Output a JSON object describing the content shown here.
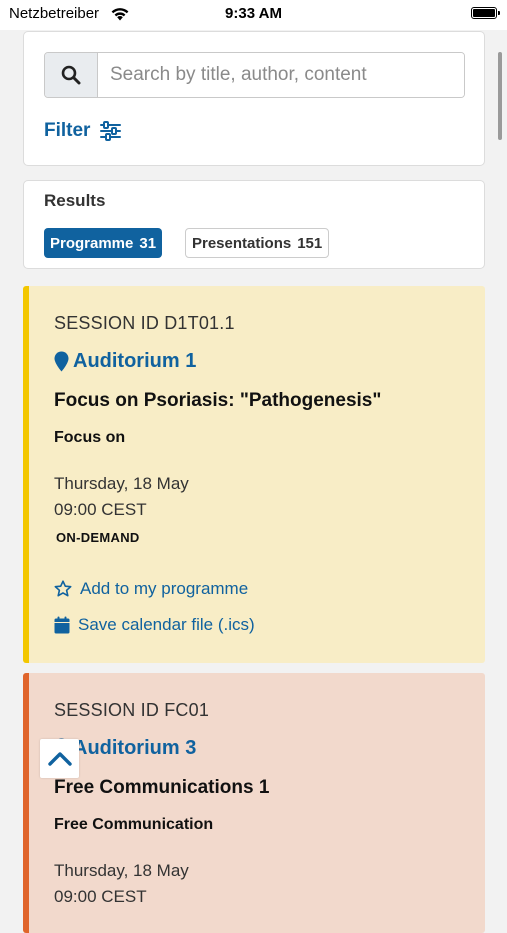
{
  "status_bar": {
    "carrier": "Netzbetreiber",
    "time": "9:33 AM"
  },
  "search": {
    "placeholder": "Search by title, author, content",
    "value": ""
  },
  "filter": {
    "label": "Filter"
  },
  "results": {
    "title": "Results",
    "tabs": [
      {
        "label": "Programme",
        "count": "31",
        "active": true
      },
      {
        "label": "Presentations",
        "count": "151",
        "active": false
      }
    ]
  },
  "sessions": [
    {
      "session_id": "SESSION ID D1T01.1",
      "room": "Auditorium 1",
      "title": "Focus on Psoriasis: \"Pathogenesis\"",
      "type": "Focus on",
      "date": "Thursday, 18 May",
      "time": "09:00 CEST",
      "badge": "ON-DEMAND",
      "add_label": "Add to my programme",
      "calendar_label": "Save calendar file (.ics)",
      "accent_color": "#f3c700",
      "background_color": "#f8edc6"
    },
    {
      "session_id": "SESSION ID FC01",
      "room": "Auditorium 3",
      "title": "Free Communications 1",
      "type": "Free Communication",
      "date": "Thursday, 18 May",
      "time": "09:00 CEST",
      "accent_color": "#e0652b",
      "background_color": "#f2d9cc"
    }
  ],
  "colors": {
    "primary": "#10629f"
  },
  "icons": {
    "search": "search-icon",
    "filter": "sliders-icon",
    "location": "map-pin-icon",
    "star": "star-outline-icon",
    "calendar": "calendar-icon",
    "scroll_top": "chevron-up-icon"
  }
}
